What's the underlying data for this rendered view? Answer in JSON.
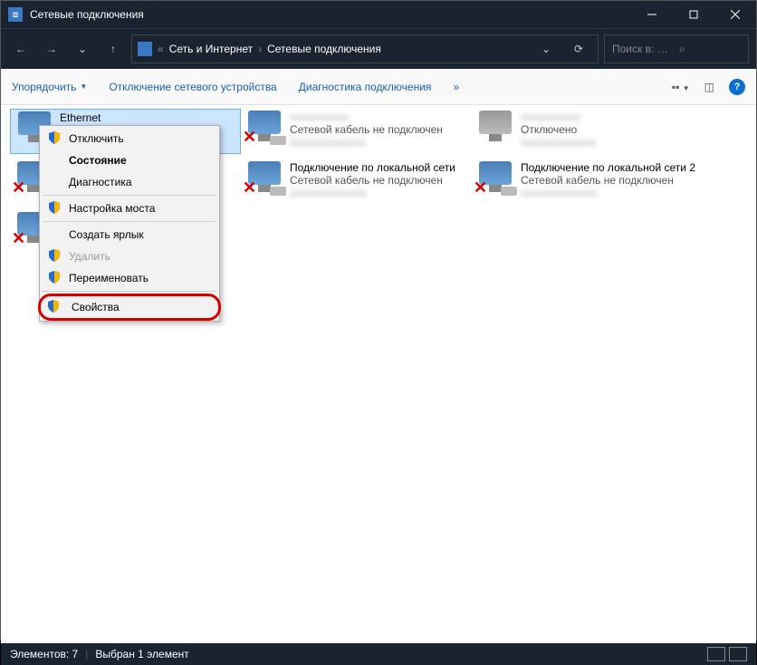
{
  "window": {
    "title": "Сетевые подключения"
  },
  "nav": {
    "crumb1": "Сеть и Интернет",
    "crumb2": "Сетевые подключения",
    "search_placeholder": "Поиск в: Сетевые по..."
  },
  "toolbar": {
    "organize": "Упорядочить",
    "disable": "Отключение сетевого устройства",
    "diag": "Диагностика подключения"
  },
  "connections": [
    {
      "name": "Ethernet",
      "status": "",
      "adapter": "",
      "sel": true,
      "x": false,
      "off": false
    },
    {
      "name": "",
      "status": "Сетевой кабель не подключен",
      "adapter": "",
      "sel": false,
      "x": true,
      "off": false
    },
    {
      "name": "",
      "status": "Отключено",
      "adapter": "",
      "sel": false,
      "x": false,
      "off": true
    },
    {
      "name": "",
      "status": "",
      "adapter": "",
      "sel": false,
      "x": true,
      "off": false
    },
    {
      "name": "Подключение по локальной сети",
      "status": "Сетевой кабель не подключен",
      "adapter": "",
      "sel": false,
      "x": true,
      "off": false
    },
    {
      "name": "Подключение по локальной сети 2",
      "status": "Сетевой кабель не подключен",
      "adapter": "",
      "sel": false,
      "x": true,
      "off": false
    },
    {
      "name": "",
      "status": "",
      "adapter": "",
      "sel": false,
      "x": true,
      "off": false
    }
  ],
  "menu": {
    "disable": "Отключить",
    "status": "Состояние",
    "diag": "Диагностика",
    "bridge": "Настройка моста",
    "shortcut": "Создать ярлык",
    "delete": "Удалить",
    "rename": "Переименовать",
    "props": "Свойства"
  },
  "status": {
    "count": "Элементов: 7",
    "selected": "Выбран 1 элемент"
  }
}
